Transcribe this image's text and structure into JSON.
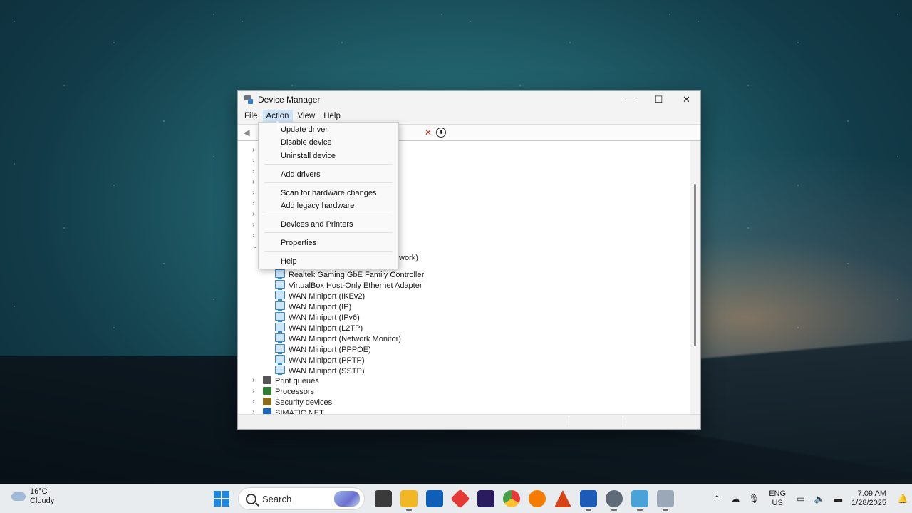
{
  "window": {
    "title": "Device Manager",
    "controls": {
      "minimize": "—",
      "maximize": "☐",
      "close": "✕"
    }
  },
  "menubar": {
    "items": [
      {
        "label": "File"
      },
      {
        "label": "Action",
        "active": true
      },
      {
        "label": "View"
      },
      {
        "label": "Help"
      }
    ]
  },
  "context_menu": {
    "items": [
      {
        "label": "Update driver"
      },
      {
        "label": "Disable device"
      },
      {
        "label": "Uninstall device"
      },
      {
        "label": "Add drivers"
      },
      {
        "label": "Scan for hardware changes"
      },
      {
        "label": "Add legacy hardware"
      },
      {
        "label": "Devices and Printers"
      },
      {
        "label": "Properties"
      },
      {
        "label": "Help"
      }
    ]
  },
  "tree": {
    "partial_text": "work)",
    "network_adapters": [
      "Realtek Gaming GbE Family Controller",
      "VirtualBox Host-Only Ethernet Adapter",
      "WAN Miniport (IKEv2)",
      "WAN Miniport (IP)",
      "WAN Miniport (IPv6)",
      "WAN Miniport (L2TP)",
      "WAN Miniport (Network Monitor)",
      "WAN Miniport (PPPOE)",
      "WAN Miniport (PPTP)",
      "WAN Miniport (SSTP)"
    ],
    "categories": [
      "Print queues",
      "Processors",
      "Security devices",
      "SIMATIC NET"
    ]
  },
  "taskbar": {
    "weather": {
      "temp": "16°C",
      "condition": "Cloudy"
    },
    "search_label": "Search",
    "tray": {
      "lang": "ENG",
      "region": "US",
      "time": "7:09 AM",
      "date": "1/28/2025"
    }
  }
}
